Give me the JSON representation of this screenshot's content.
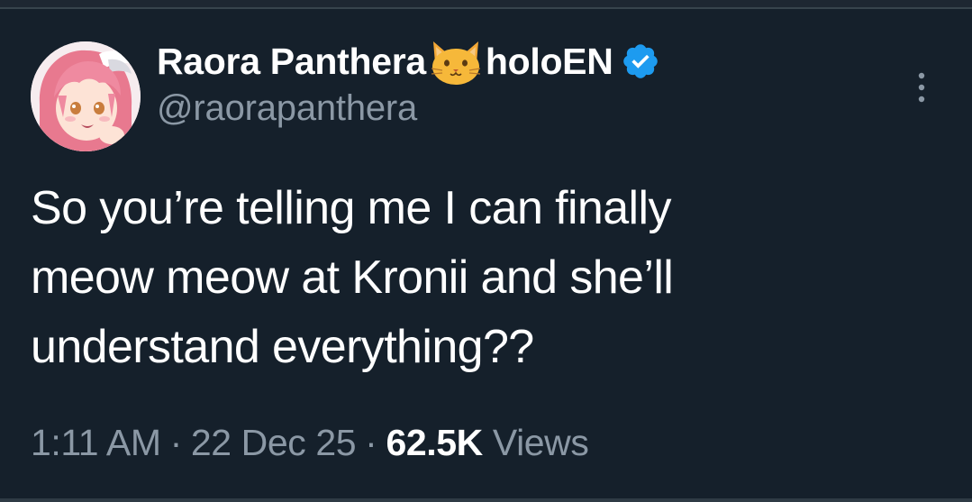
{
  "tweet": {
    "display_name_part1": "Raora Panthera",
    "display_name_part2": "holoEN",
    "name_emoji": "cat-face-icon",
    "verified_icon": "verified-badge-icon",
    "handle": "@raorapanthera",
    "text_lines": [
      "So you’re telling me I can finally",
      "meow meow at Kronii and she’ll",
      "understand everything??"
    ],
    "time": "1:11 AM",
    "date": "22 Dec 25",
    "views_count": "62.5K",
    "views_label": "Views",
    "separator": "·"
  },
  "colors": {
    "background": "#15202b",
    "secondary_text": "#8b98a5",
    "verified_blue": "#1d9bf0",
    "primary_text": "#ffffff"
  }
}
